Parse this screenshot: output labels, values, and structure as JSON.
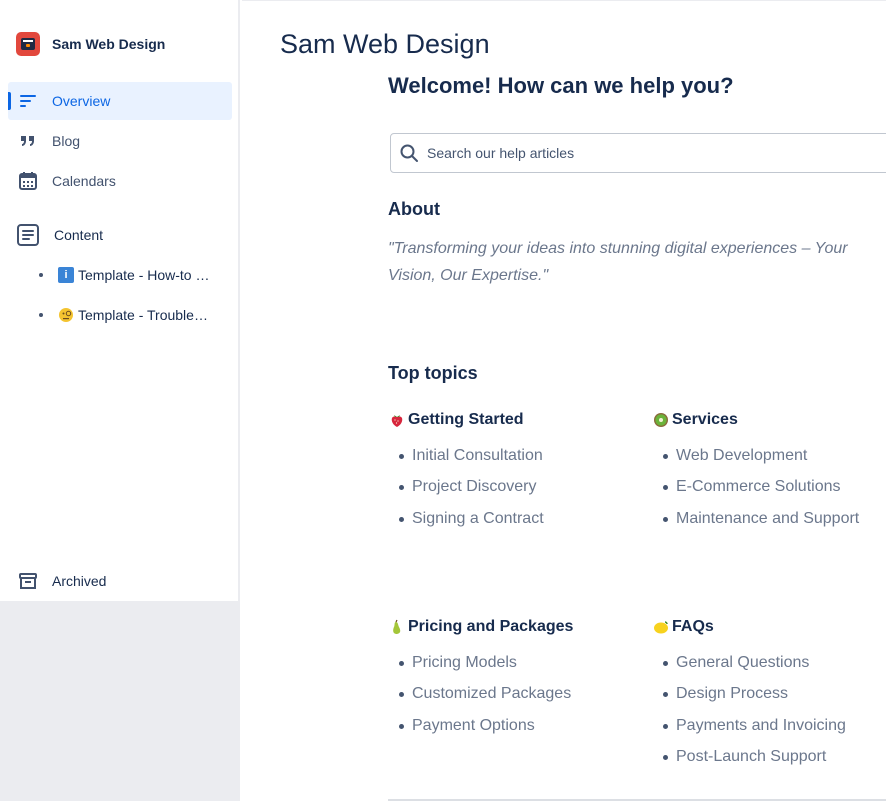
{
  "space": {
    "name": "Sam Web Design"
  },
  "sidebar": {
    "nav": [
      {
        "label": "Overview",
        "icon": "overview-icon"
      },
      {
        "label": "Blog",
        "icon": "quote-icon"
      },
      {
        "label": "Calendars",
        "icon": "calendar-icon"
      }
    ],
    "content_label": "Content",
    "tree": [
      {
        "label": "Template - How-to guide",
        "icon": "info-icon"
      },
      {
        "label": "Template - Troubleshooting",
        "icon": "face-with-monocle-icon"
      }
    ],
    "archived_label": "Archived"
  },
  "main": {
    "page_title": "Sam Web Design",
    "welcome": "Welcome! How can we help you?",
    "search": {
      "placeholder": "Search our help articles"
    },
    "about_heading": "About",
    "about_text": "\"Transforming your ideas into stunning digital experiences – Your Vision, Our Expertise.\"",
    "topics_heading": "Top topics",
    "topics": [
      {
        "title": "Getting Started",
        "icon": "strawberry-icon",
        "items": [
          "Initial Consultation",
          "Project Discovery",
          "Signing a Contract"
        ]
      },
      {
        "title": "Services",
        "icon": "kiwi-icon",
        "items": [
          "Web Development",
          "E-Commerce Solutions",
          "Maintenance and Support"
        ]
      },
      {
        "title": "Pricing and Packages",
        "icon": "pear-icon",
        "items": [
          "Pricing Models",
          "Customized Packages",
          "Payment Options"
        ]
      },
      {
        "title": "FAQs",
        "icon": "lemon-icon",
        "items": [
          "General Questions",
          "Design Process",
          "Payments and Invoicing",
          "Post-Launch Support"
        ]
      }
    ]
  },
  "colors": {
    "accent": "#0c66e4",
    "active_bg": "#e9f2ff",
    "logo": "#e2483d"
  }
}
